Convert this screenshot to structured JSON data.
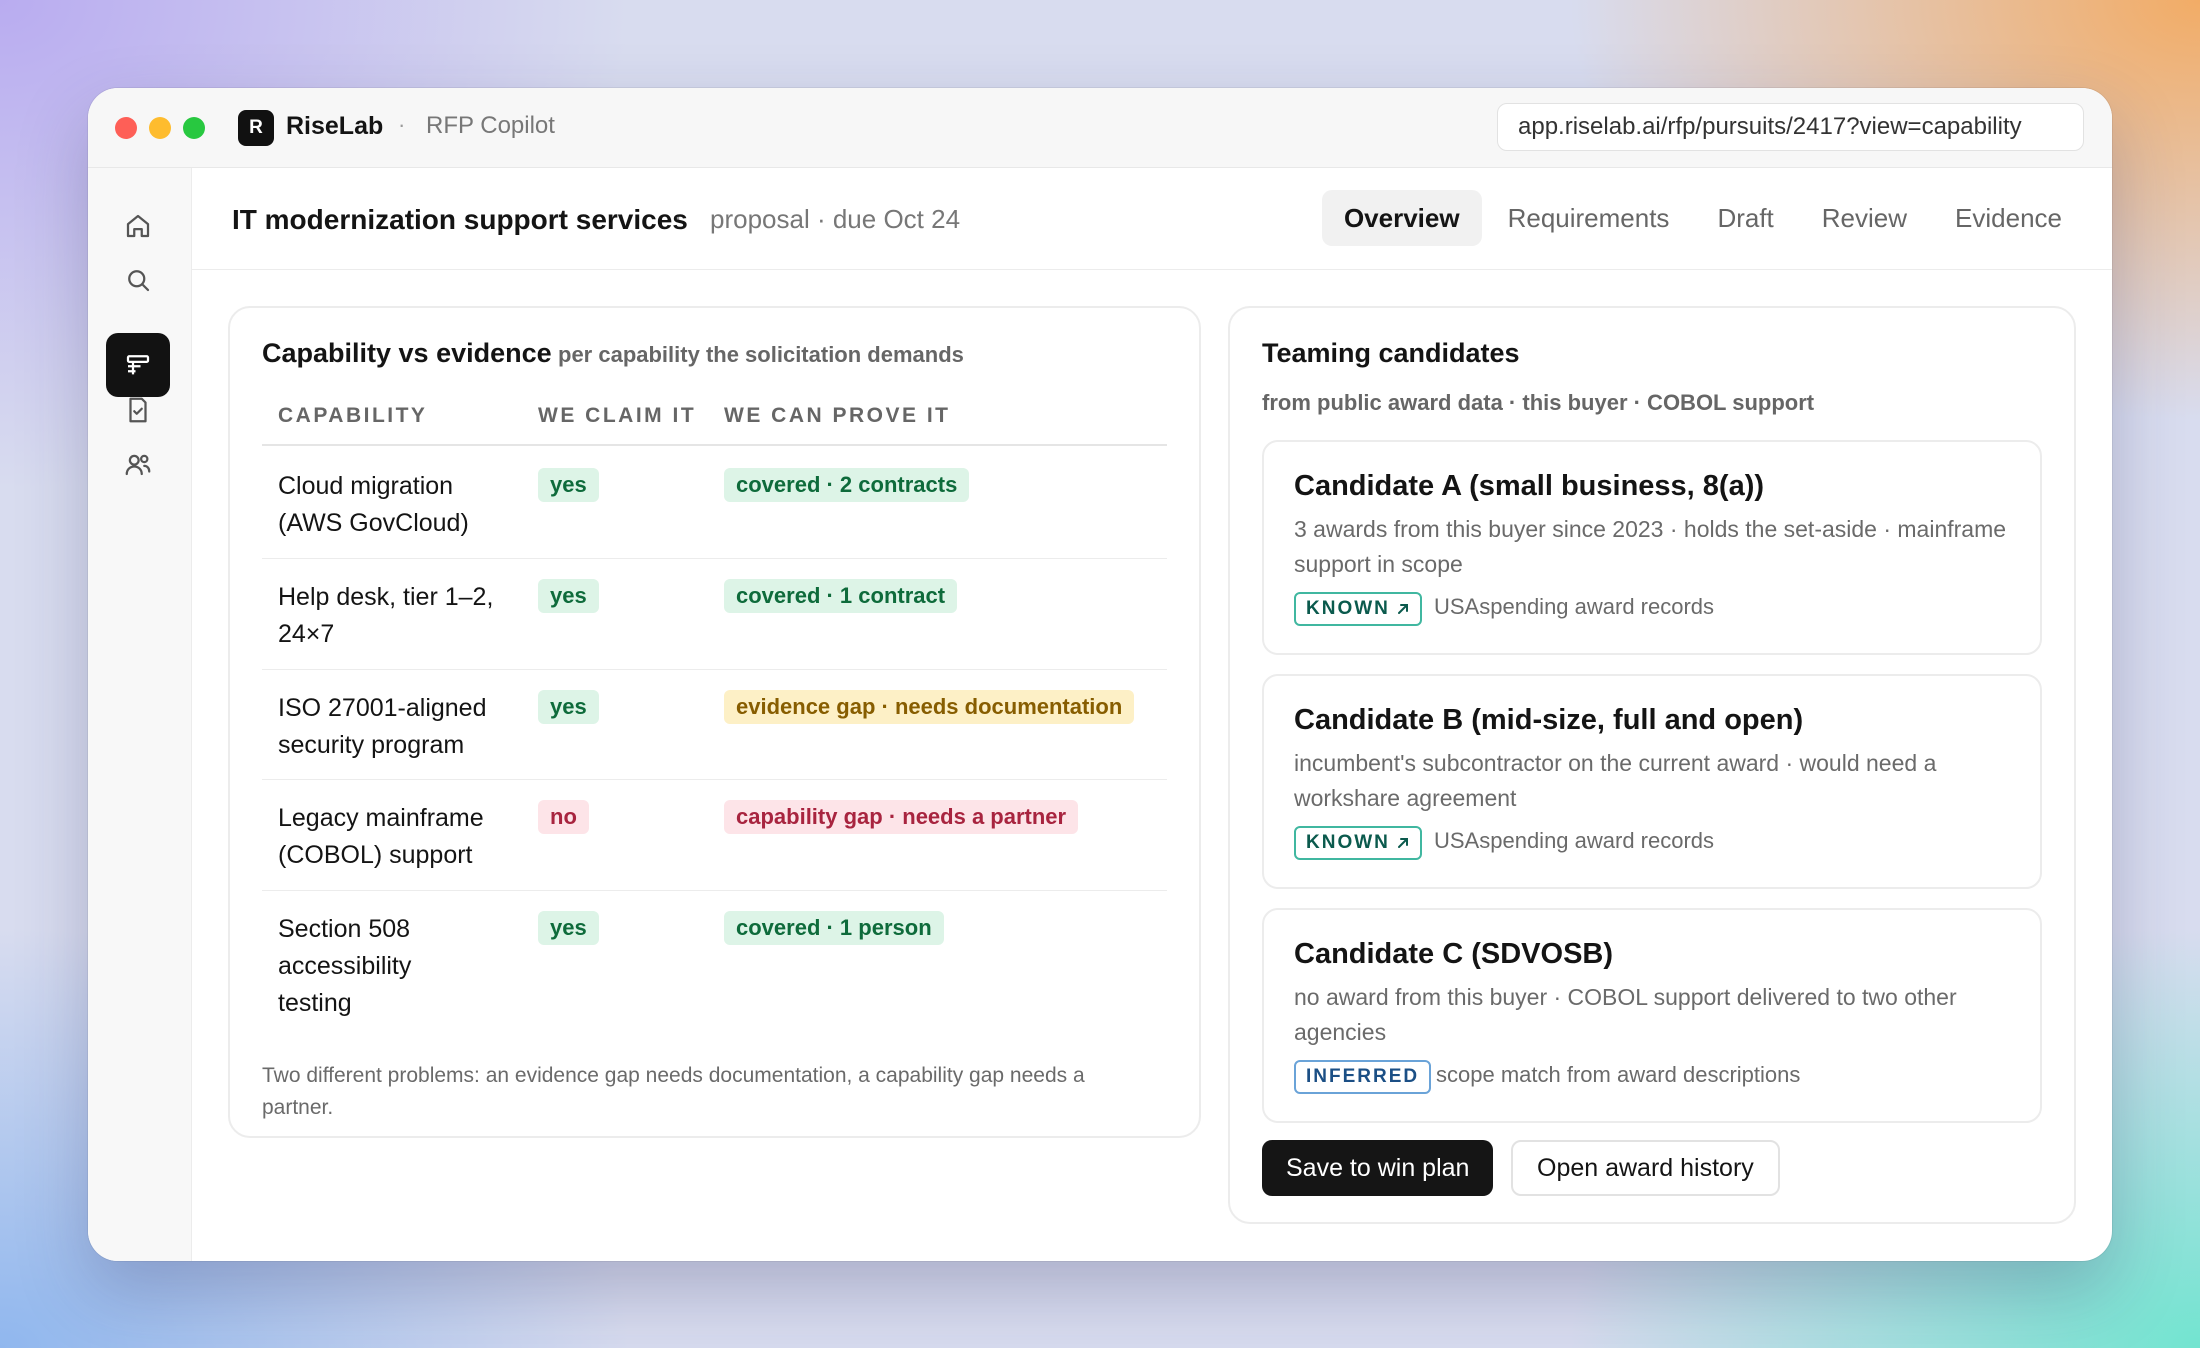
{
  "window": {
    "brand_letter": "R",
    "brand": "RiseLab",
    "separator": "·",
    "app_name": "RFP Copilot",
    "url": "app.riselab.ai/rfp/pursuits/2417?view=capability"
  },
  "sidebar": {
    "items": [
      {
        "name": "home",
        "icon": "home-icon"
      },
      {
        "name": "search",
        "icon": "search-icon"
      },
      {
        "name": "proposals",
        "icon": "proposal-icon",
        "active": true
      },
      {
        "name": "checklist",
        "icon": "checklist-icon"
      },
      {
        "name": "team",
        "icon": "users-icon"
      }
    ]
  },
  "header": {
    "title": "IT modernization support services",
    "separator": "·",
    "meta": "proposal · due Oct 24",
    "tabs": [
      {
        "label": "Overview",
        "active": true
      },
      {
        "label": "Requirements"
      },
      {
        "label": "Draft"
      },
      {
        "label": "Review"
      },
      {
        "label": "Evidence"
      }
    ]
  },
  "capability": {
    "title": "Capability vs evidence",
    "subtitle": "per capability the solicitation demands",
    "columns": [
      "CAPABILITY",
      "WE CLAIM IT",
      "WE CAN PROVE IT"
    ],
    "rows": [
      {
        "capability": "Cloud migration (AWS GovCloud)",
        "claim": "yes",
        "claim_status": "green",
        "proof": "covered · 2 contracts",
        "proof_status": "green"
      },
      {
        "capability": "Help desk, tier 1–2, 24×7",
        "claim": "yes",
        "claim_status": "green",
        "proof": "covered · 1 contract",
        "proof_status": "green"
      },
      {
        "capability": "ISO 27001-aligned security program",
        "claim": "yes",
        "claim_status": "green",
        "proof": "evidence gap · needs documentation",
        "proof_status": "yellow"
      },
      {
        "capability": "Legacy mainframe (COBOL) support",
        "claim": "no",
        "claim_status": "red",
        "proof": "capability gap · needs a partner",
        "proof_status": "red"
      },
      {
        "capability": "Section 508 accessibility testing",
        "claim": "yes",
        "claim_status": "green",
        "proof": "covered · 1 person",
        "proof_status": "green"
      }
    ],
    "note": "Two different problems: an evidence gap needs documentation, a capability gap needs a partner.",
    "colors": {
      "green_bg": "#ddf4e7",
      "yellow_bg": "#fdf0c6",
      "red_bg": "#fde4e8"
    }
  },
  "teaming": {
    "title": "Teaming candidates",
    "subtitle": "from public award data · this buyer · COBOL support",
    "candidates": [
      {
        "name": "Candidate A (small business, 8(a))",
        "desc": "3 awards from this buyer since 2023 · holds the set-aside · mainframe support in scope",
        "tag": "KNOWN",
        "tag_icon": "arrow-up-right-icon",
        "source": "USAspending award records"
      },
      {
        "name": "Candidate B (mid-size, full and open)",
        "desc": "incumbent's subcontractor on the current award · would need a workshare agreement",
        "tag": "KNOWN",
        "tag_icon": "arrow-up-right-icon",
        "source": "USAspending award records"
      },
      {
        "name": "Candidate C (SDVOSB)",
        "desc": "no award from this buyer · COBOL support delivered to two other agencies",
        "tag": "INFERRED",
        "source": "scope match from award descriptions"
      }
    ],
    "actions": {
      "primary": "Save to win plan",
      "secondary": "Open award history"
    }
  }
}
